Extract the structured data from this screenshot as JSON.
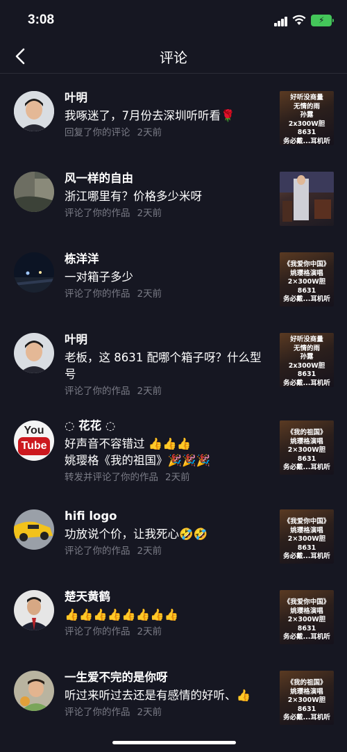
{
  "status_bar": {
    "time": "3:08"
  },
  "header": {
    "title": "评论"
  },
  "comments": [
    {
      "name": "叶明",
      "text": "我啄迷了，7月份去深圳听听看🌹",
      "action": "回复了你的评论",
      "time": "2天前",
      "thumb_text": "好听没商量\n无情的雨\n孙露\n2x300W胆8631\n务必戴...耳机听"
    },
    {
      "name": "风一样的自由",
      "text": "浙江哪里有？价格多少米呀",
      "action": "评论了你的作品",
      "time": "2天前",
      "thumb_text": ""
    },
    {
      "name": "栋洋洋",
      "text": "一对箱子多少",
      "action": "评论了你的作品",
      "time": "2天前",
      "thumb_text": "《我爱你中国》\n姚璎格演唱\n2×300W胆8631\n务必戴...耳机听"
    },
    {
      "name": "叶明",
      "text": "老板，这 8631 配哪个箱子呀？什么型号",
      "action": "评论了你的作品",
      "time": "2天前",
      "thumb_text": "好听没商量\n无情的雨\n孙露\n2x300W胆8631\n务必戴...耳机听"
    },
    {
      "name": "◌ 花花 ◌",
      "text": "好声音不容错过 👍👍👍\n姚璎格《我的祖国》🎉🎉🎉",
      "action": "转发并评论了你的作品",
      "time": "2天前",
      "thumb_text": "《我的祖国》\n姚璎格演唱\n2×300W胆8631\n务必戴...耳机听"
    },
    {
      "name": "hifi logo",
      "text": "功放说个价，让我死心🤣🤣",
      "action": "评论了你的作品",
      "time": "2天前",
      "thumb_text": "《我爱你中国》\n姚璎格演唱\n2×300W胆8631\n务必戴...耳机听"
    },
    {
      "name": "楚天黄鹤",
      "text": "👍👍👍👍👍👍👍👍",
      "action": "评论了你的作品",
      "time": "2天前",
      "thumb_text": "《我爱你中国》\n姚璎格演唱\n2×300W胆8631\n务必戴...耳机听"
    },
    {
      "name": "一生爱不完的是你呀",
      "text": "听过来听过去还是有感情的好听、👍",
      "action": "评论了你的作品",
      "time": "2天前",
      "thumb_text": "《我的祖国》\n姚璎格演唱\n2×300W胆8631\n务必戴...耳机听"
    }
  ],
  "avatars": {
    "youtube_logo": "You\nTube"
  },
  "colors": {
    "background": "#161722",
    "meta_text": "#7b7c87",
    "battery": "#44c65a",
    "youtube_red": "#cc181e"
  }
}
